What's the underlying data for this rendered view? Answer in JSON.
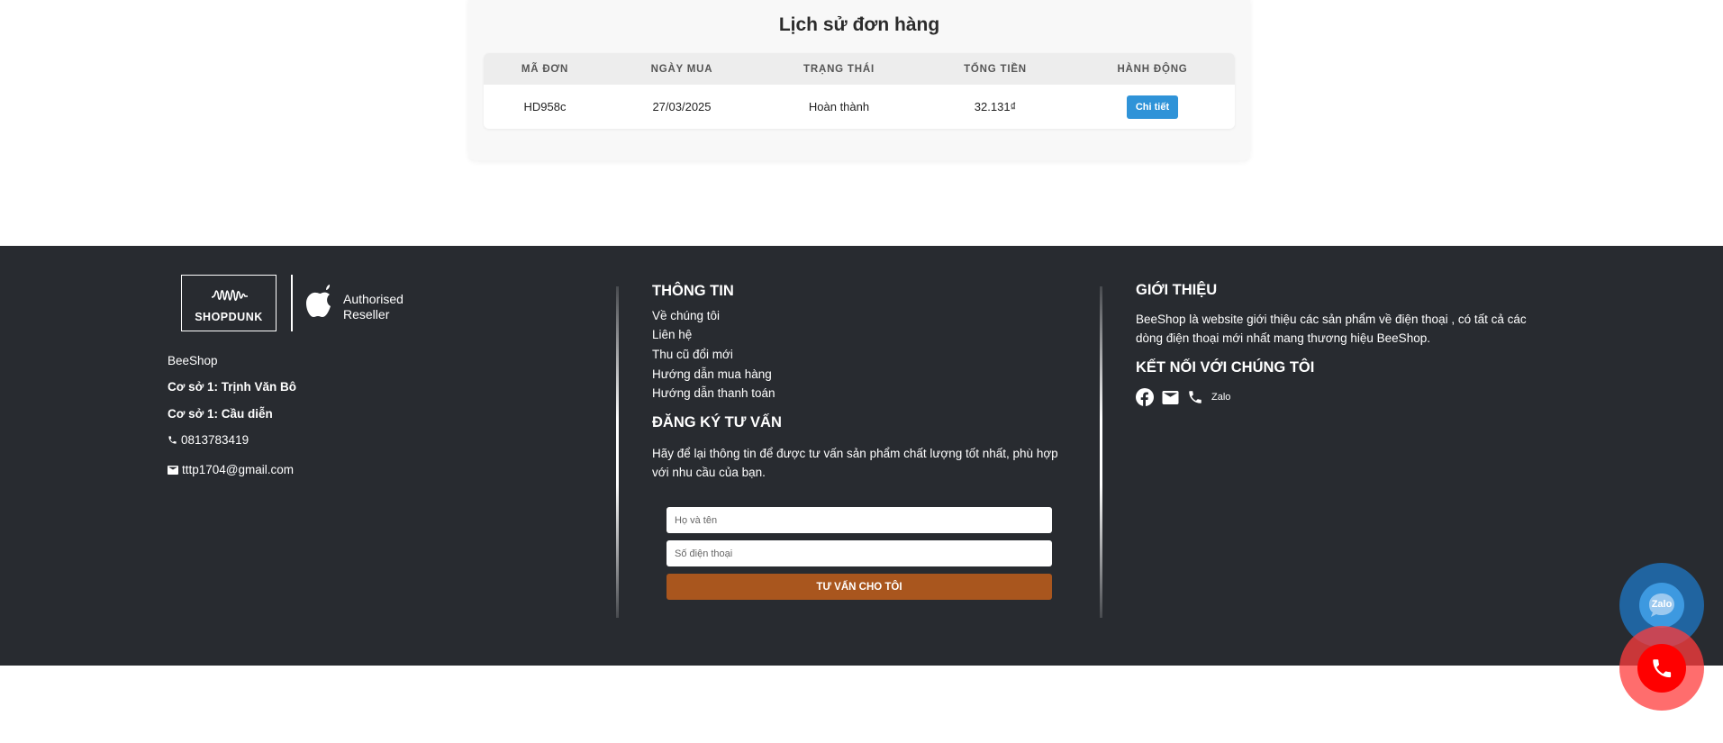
{
  "orders": {
    "title": "Lịch sử đơn hàng",
    "columns": [
      "MÃ ĐƠN",
      "NGÀY MUA",
      "TRẠNG THÁI",
      "TỔNG TIỀN",
      "HÀNH ĐỘNG"
    ],
    "rows": [
      {
        "code": "HD958c",
        "date": "27/03/2025",
        "status": "Hoàn thành",
        "total": "32.131₫",
        "action": "Chi tiết"
      }
    ]
  },
  "footer": {
    "brand": {
      "logo_text": "SHOPDUNK",
      "reseller_line1": "Authorised",
      "reseller_line2": "Reseller"
    },
    "info": {
      "shop_name": "BeeShop",
      "branch1": "Cơ sở 1: Trịnh Văn Bô",
      "branch2": "Cơ sở 1: Cầu diễn",
      "phone": "0813783419",
      "email": "tttp1704@gmail.com"
    },
    "thong_tin": {
      "heading": "THÔNG TIN",
      "links": [
        "Về chúng tôi",
        "Liên hệ",
        "Thu cũ đổi mới",
        "Hướng dẫn mua hàng",
        "Hướng dẫn thanh toán"
      ]
    },
    "consult": {
      "heading": "ĐĂNG KÝ TƯ VẤN",
      "text": "Hãy để lại thông tin để được tư vấn sản phẩm chất lượng tốt nhất, phù hợp với nhu cầu của bạn.",
      "name_placeholder": "Họ và tên",
      "phone_placeholder": "Số điện thoại",
      "submit_label": "TƯ VẤN CHO TÔI"
    },
    "about": {
      "heading": "GIỚI THIỆU",
      "text": "BeeShop là website giới thiệu các sản phẩm về điện thoại , có tất cả các dòng điện thoại mới nhất mang thương hiệu BeeShop.",
      "connect_heading": "KẾT NỐI VỚI CHÚNG TÔI",
      "zalo_label": "Zalo",
      "social_icons": [
        "facebook-icon",
        "mail-icon",
        "phone-icon"
      ]
    }
  },
  "floating": {
    "zalo_label": "Zalo"
  },
  "colors": {
    "footer_bg": "#282b30",
    "detail_button": "#2f93d8",
    "submit_button": "#a9561e",
    "call_button": "#ff0000"
  }
}
